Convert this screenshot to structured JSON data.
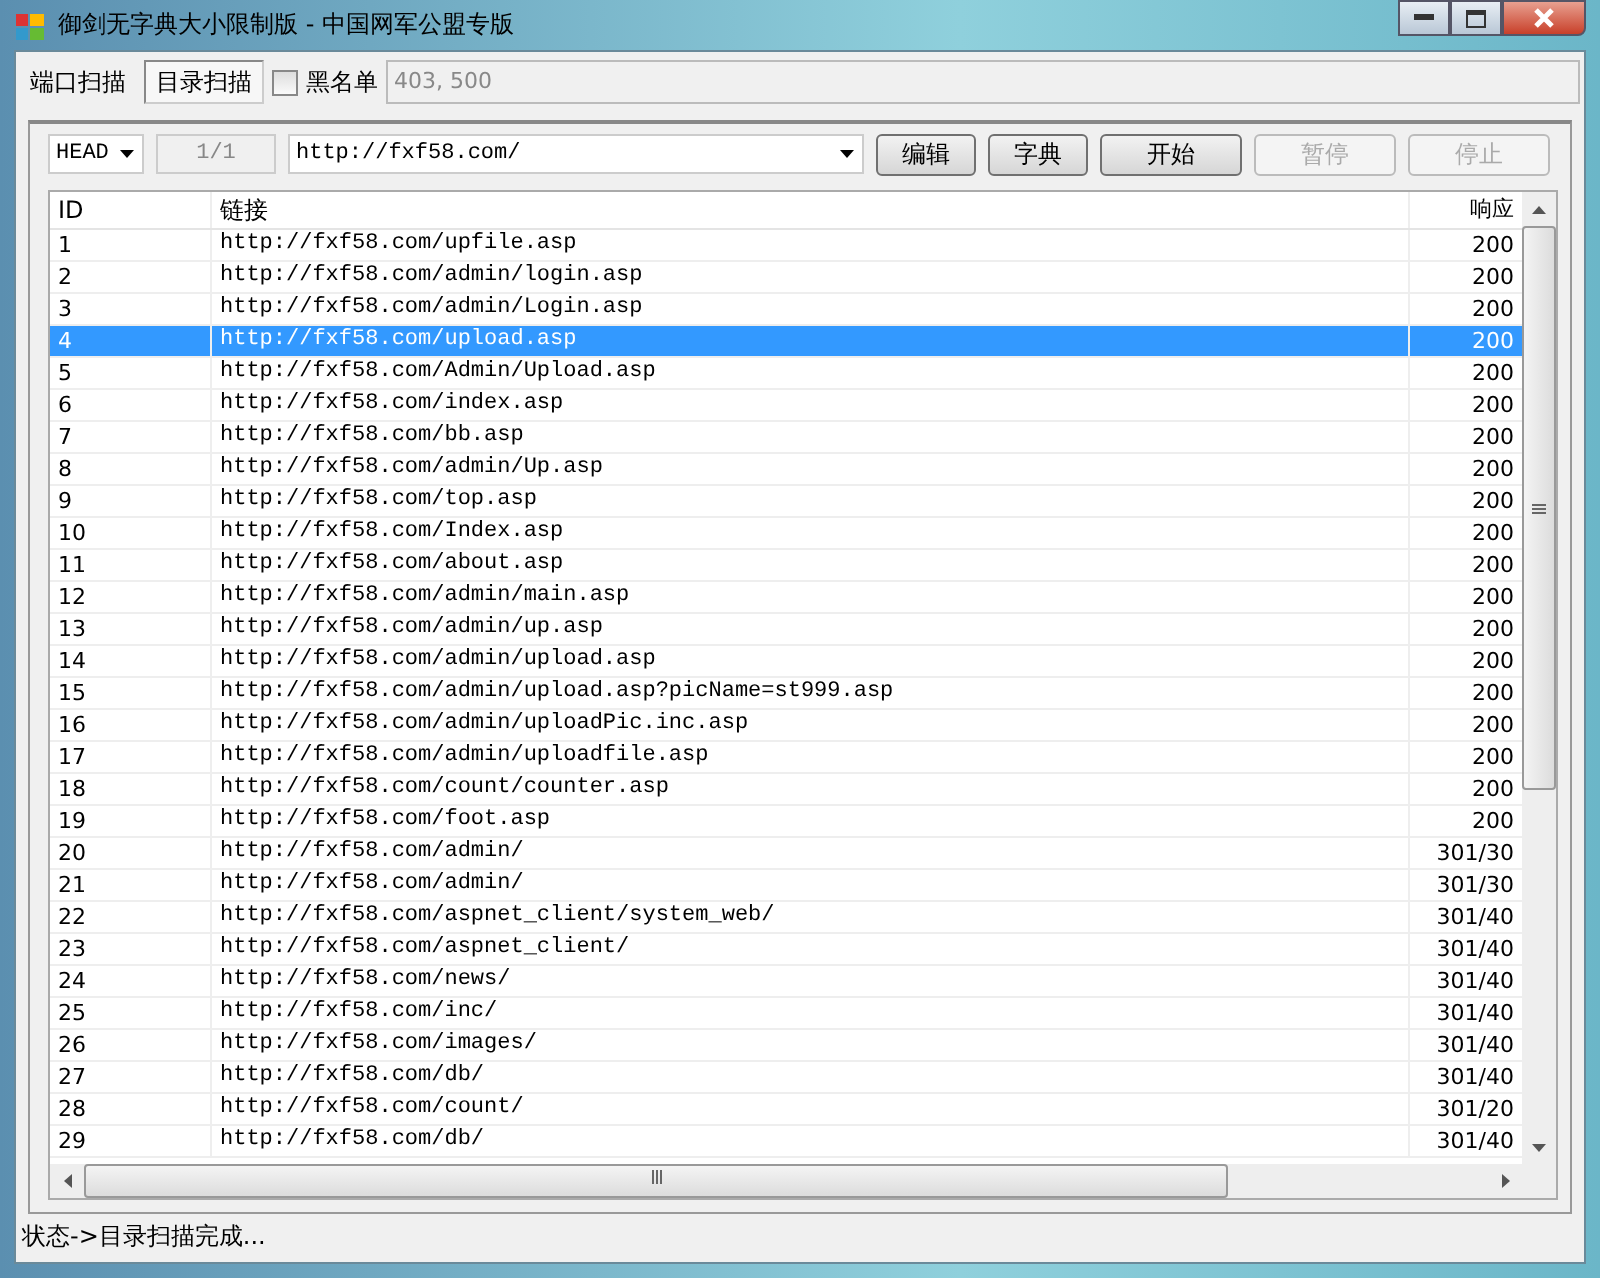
{
  "window": {
    "title": "御剑无字典大小限制版 - 中国网军公盟专版"
  },
  "tabs": [
    {
      "label": "端口扫描",
      "selected": false
    },
    {
      "label": "目录扫描",
      "selected": true
    }
  ],
  "blacklist": {
    "label": "黑名单",
    "checked": false,
    "value": "403, 500"
  },
  "toolbar": {
    "method": "HEAD",
    "progress": "1/1",
    "url": "http://fxf58.com/",
    "buttons": [
      {
        "label": "编辑",
        "disabled": false
      },
      {
        "label": "字典",
        "disabled": false
      },
      {
        "label": "开始",
        "disabled": false
      },
      {
        "label": "暂停",
        "disabled": true
      },
      {
        "label": "停止",
        "disabled": true
      }
    ]
  },
  "table": {
    "columns": [
      "ID",
      "链接",
      "响应"
    ],
    "rows": [
      {
        "id": "1",
        "link": "http://fxf58.com/upfile.asp",
        "response": "200",
        "selected": false
      },
      {
        "id": "2",
        "link": "http://fxf58.com/admin/login.asp",
        "response": "200",
        "selected": false
      },
      {
        "id": "3",
        "link": "http://fxf58.com/admin/Login.asp",
        "response": "200",
        "selected": false
      },
      {
        "id": "4",
        "link": "http://fxf58.com/upload.asp",
        "response": "200",
        "selected": true
      },
      {
        "id": "5",
        "link": "http://fxf58.com/Admin/Upload.asp",
        "response": "200",
        "selected": false
      },
      {
        "id": "6",
        "link": "http://fxf58.com/index.asp",
        "response": "200",
        "selected": false
      },
      {
        "id": "7",
        "link": "http://fxf58.com/bb.asp",
        "response": "200",
        "selected": false
      },
      {
        "id": "8",
        "link": "http://fxf58.com/admin/Up.asp",
        "response": "200",
        "selected": false
      },
      {
        "id": "9",
        "link": "http://fxf58.com/top.asp",
        "response": "200",
        "selected": false
      },
      {
        "id": "10",
        "link": "http://fxf58.com/Index.asp",
        "response": "200",
        "selected": false
      },
      {
        "id": "11",
        "link": "http://fxf58.com/about.asp",
        "response": "200",
        "selected": false
      },
      {
        "id": "12",
        "link": "http://fxf58.com/admin/main.asp",
        "response": "200",
        "selected": false
      },
      {
        "id": "13",
        "link": "http://fxf58.com/admin/up.asp",
        "response": "200",
        "selected": false
      },
      {
        "id": "14",
        "link": "http://fxf58.com/admin/upload.asp",
        "response": "200",
        "selected": false
      },
      {
        "id": "15",
        "link": "http://fxf58.com/admin/upload.asp?picName=st999.asp",
        "response": "200",
        "selected": false
      },
      {
        "id": "16",
        "link": "http://fxf58.com/admin/uploadPic.inc.asp",
        "response": "200",
        "selected": false
      },
      {
        "id": "17",
        "link": "http://fxf58.com/admin/uploadfile.asp",
        "response": "200",
        "selected": false
      },
      {
        "id": "18",
        "link": "http://fxf58.com/count/counter.asp",
        "response": "200",
        "selected": false
      },
      {
        "id": "19",
        "link": "http://fxf58.com/foot.asp",
        "response": "200",
        "selected": false
      },
      {
        "id": "20",
        "link": "http://fxf58.com/admin/",
        "response": "301/30",
        "selected": false
      },
      {
        "id": "21",
        "link": "http://fxf58.com/admin/",
        "response": "301/30",
        "selected": false
      },
      {
        "id": "22",
        "link": "http://fxf58.com/aspnet_client/system_web/",
        "response": "301/40",
        "selected": false
      },
      {
        "id": "23",
        "link": "http://fxf58.com/aspnet_client/",
        "response": "301/40",
        "selected": false
      },
      {
        "id": "24",
        "link": "http://fxf58.com/news/",
        "response": "301/40",
        "selected": false
      },
      {
        "id": "25",
        "link": "http://fxf58.com/inc/",
        "response": "301/40",
        "selected": false
      },
      {
        "id": "26",
        "link": "http://fxf58.com/images/",
        "response": "301/40",
        "selected": false
      },
      {
        "id": "27",
        "link": "http://fxf58.com/db/",
        "response": "301/40",
        "selected": false
      },
      {
        "id": "28",
        "link": "http://fxf58.com/count/",
        "response": "301/20",
        "selected": false
      },
      {
        "id": "29",
        "link": "http://fxf58.com/db/",
        "response": "301/40",
        "selected": false
      }
    ]
  },
  "status_bar": {
    "text": "状态->目录扫描完成..."
  }
}
